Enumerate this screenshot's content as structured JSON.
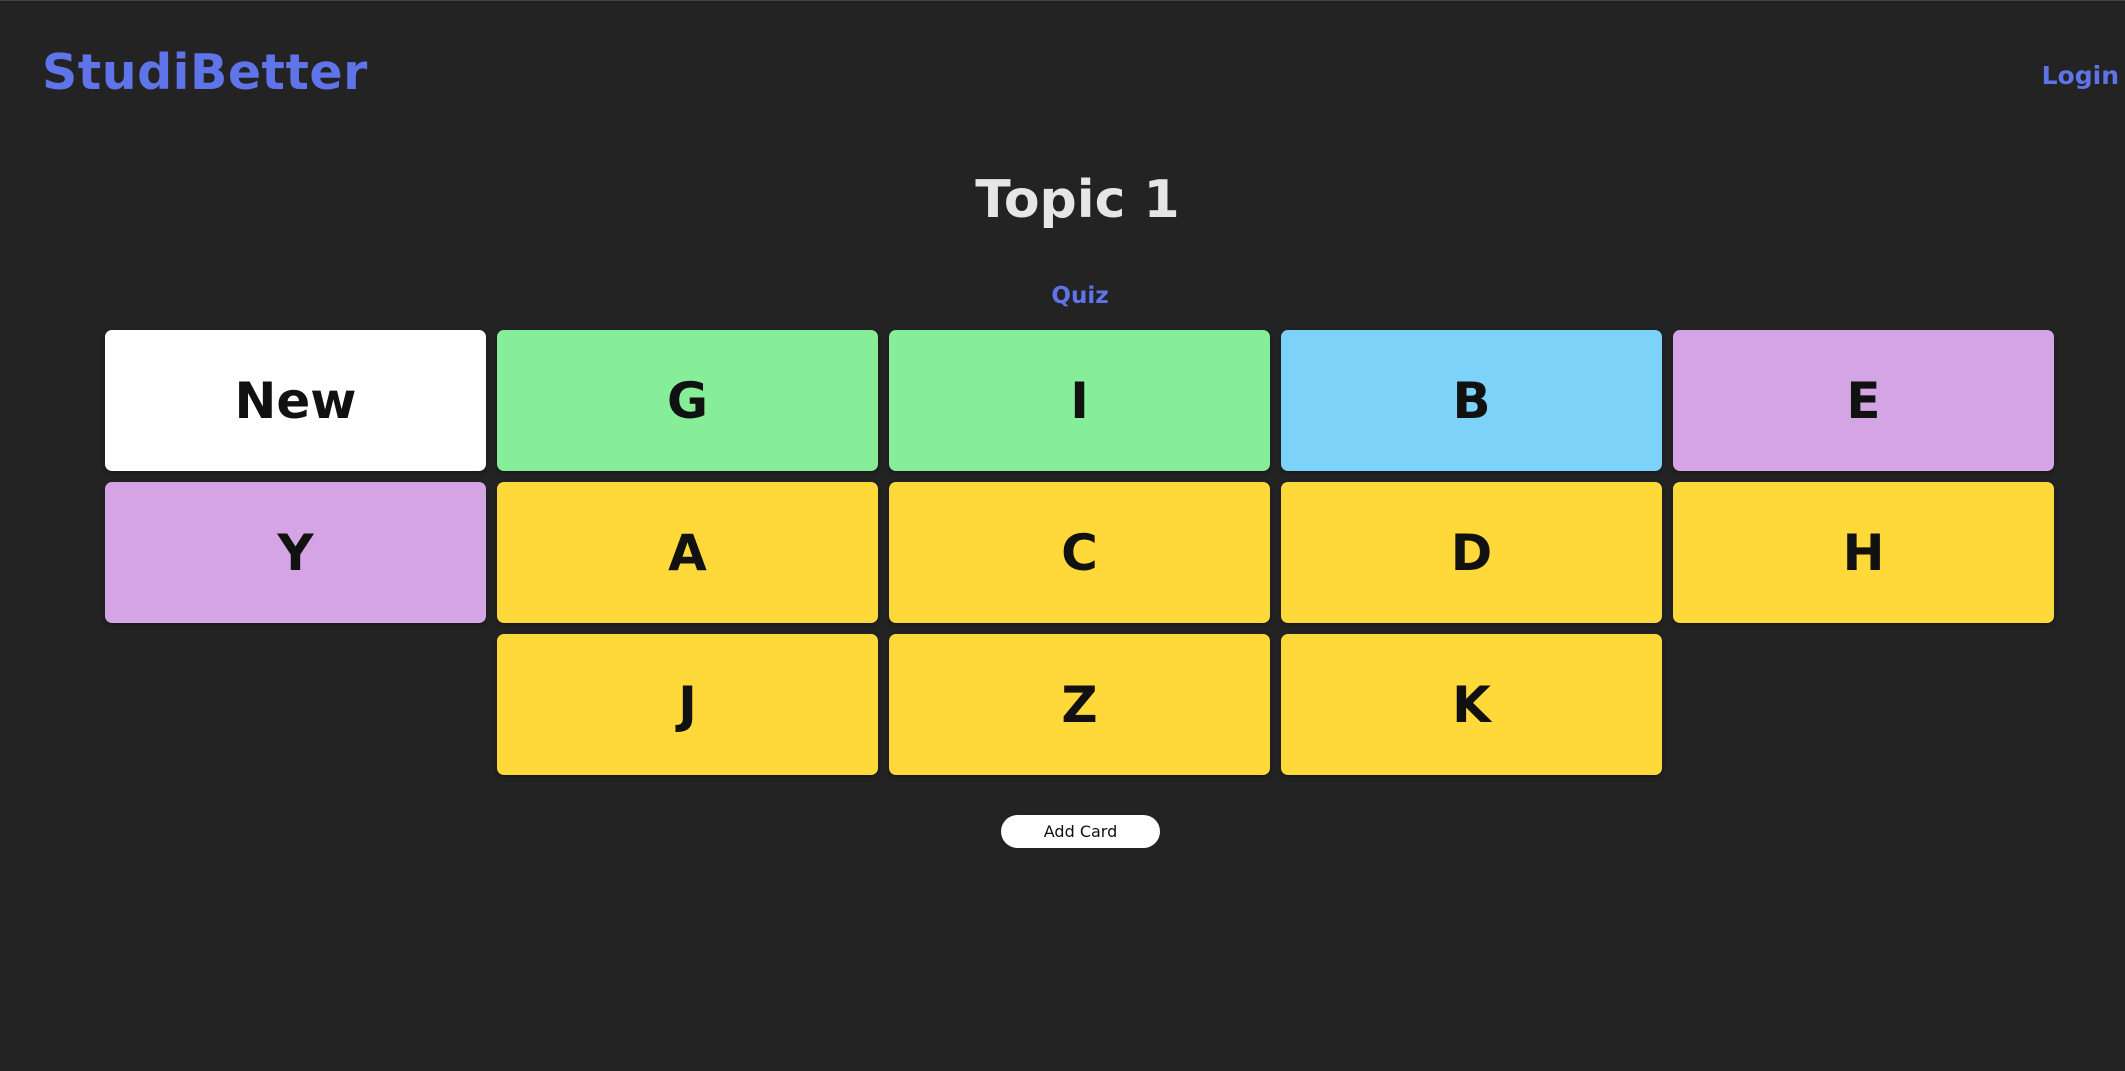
{
  "header": {
    "brand": "StudiBetter",
    "login_label": "Login"
  },
  "page": {
    "title": "Topic 1",
    "quiz_label": "Quiz",
    "add_card_label": "Add Card"
  },
  "colors": {
    "background": "#232323",
    "accent": "#5f74e8",
    "card_white": "#ffffff",
    "card_green": "#86ed99",
    "card_blue": "#7dd2f9",
    "card_purple": "#d5a4e4",
    "card_yellow": "#fed939"
  },
  "cards": [
    {
      "label": "New",
      "color": "#ffffff"
    },
    {
      "label": "G",
      "color": "#86ed99"
    },
    {
      "label": "I",
      "color": "#86ed99"
    },
    {
      "label": "B",
      "color": "#7dd2f9"
    },
    {
      "label": "E",
      "color": "#d5a4e4"
    },
    {
      "label": "Y",
      "color": "#d5a4e4"
    },
    {
      "label": "A",
      "color": "#fed939"
    },
    {
      "label": "C",
      "color": "#fed939"
    },
    {
      "label": "D",
      "color": "#fed939"
    },
    {
      "label": "H",
      "color": "#fed939"
    },
    {
      "label": "J",
      "color": "#fed939"
    },
    {
      "label": "Z",
      "color": "#fed939"
    },
    {
      "label": "K",
      "color": "#fed939"
    }
  ]
}
